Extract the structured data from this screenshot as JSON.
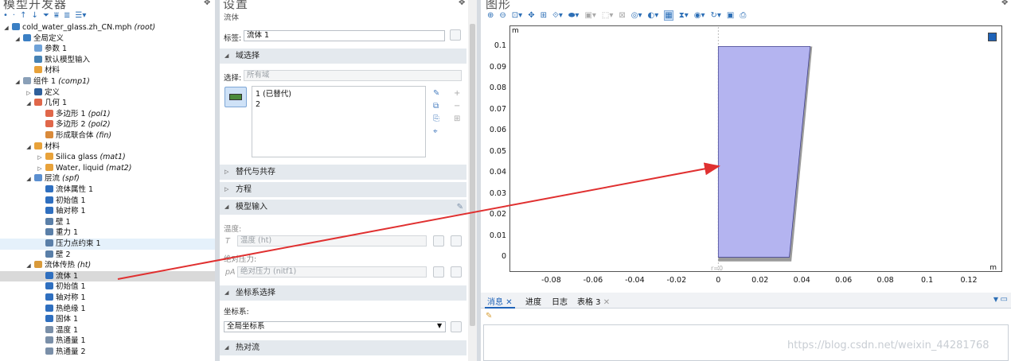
{
  "tree_panel": {
    "title": "模型开发器",
    "toolbar_icons": [
      "back-icon",
      "forward-icon",
      "up-icon",
      "down-icon",
      "filter-icon",
      "expand-all-icon",
      "collapse-all-icon",
      "view-menu-icon"
    ]
  },
  "tree": [
    {
      "indent": 0,
      "tw": "◢",
      "label": "cold_water_glass.zh_CN.mph",
      "tag": "(root)",
      "icon": "file-icon",
      "color": "#3b7fc4"
    },
    {
      "indent": 1,
      "tw": "◢",
      "label": "全局定义",
      "tag": "",
      "icon": "globe-icon",
      "color": "#3b7fc4"
    },
    {
      "indent": 2,
      "tw": "",
      "label": "参数 1",
      "tag": "",
      "icon": "parameters-icon",
      "color": "#6fa2d8"
    },
    {
      "indent": 2,
      "tw": "",
      "label": "默认模型输入",
      "tag": "",
      "icon": "model-inputs-icon",
      "color": "#4682b4"
    },
    {
      "indent": 2,
      "tw": "",
      "label": "材料",
      "tag": "",
      "icon": "materials-icon",
      "color": "#e8a23a"
    },
    {
      "indent": 1,
      "tw": "◢",
      "label": "组件 1",
      "tag": "(comp1)",
      "icon": "component-icon",
      "color": "#8aa0b8"
    },
    {
      "indent": 2,
      "tw": "▷",
      "label": "定义",
      "tag": "",
      "icon": "definitions-icon",
      "color": "#2f5f9a"
    },
    {
      "indent": 2,
      "tw": "◢",
      "label": "几何 1",
      "tag": "",
      "icon": "geometry-icon",
      "color": "#e0674a"
    },
    {
      "indent": 3,
      "tw": "",
      "label": "多边形 1",
      "tag": "(pol1)",
      "icon": "polygon-icon",
      "color": "#e0674a"
    },
    {
      "indent": 3,
      "tw": "",
      "label": "多边形 2",
      "tag": "(pol2)",
      "icon": "polygon-icon",
      "color": "#e0674a"
    },
    {
      "indent": 3,
      "tw": "",
      "label": "形成联合体",
      "tag": "(fin)",
      "icon": "form-union-icon",
      "color": "#d98a3a"
    },
    {
      "indent": 2,
      "tw": "◢",
      "label": "材料",
      "tag": "",
      "icon": "materials-icon",
      "color": "#e8a23a"
    },
    {
      "indent": 3,
      "tw": "▷",
      "label": "Silica glass",
      "tag": "(mat1)",
      "icon": "material-icon",
      "color": "#e8a23a"
    },
    {
      "indent": 3,
      "tw": "▷",
      "label": "Water, liquid",
      "tag": "(mat2)",
      "icon": "material-icon",
      "color": "#e8a23a"
    },
    {
      "indent": 2,
      "tw": "◢",
      "label": "层流",
      "tag": "(spf)",
      "icon": "laminar-flow-icon",
      "color": "#5b8fd0"
    },
    {
      "indent": 3,
      "tw": "",
      "label": "流体属性 1",
      "tag": "",
      "icon": "fluid-properties-icon",
      "color": "#2f6fbf"
    },
    {
      "indent": 3,
      "tw": "",
      "label": "初始值 1",
      "tag": "",
      "icon": "initial-values-icon",
      "color": "#2f6fbf"
    },
    {
      "indent": 3,
      "tw": "",
      "label": "轴对称 1",
      "tag": "",
      "icon": "axial-symmetry-icon",
      "color": "#2f6fbf"
    },
    {
      "indent": 3,
      "tw": "",
      "label": "壁 1",
      "tag": "",
      "icon": "wall-icon",
      "color": "#5a7fa8"
    },
    {
      "indent": 3,
      "tw": "",
      "label": "重力 1",
      "tag": "",
      "icon": "gravity-icon",
      "color": "#5a7fa8"
    },
    {
      "indent": 3,
      "tw": "",
      "label": "压力点约束 1",
      "tag": "",
      "icon": "pressure-point-icon",
      "color": "#5a7fa8",
      "hl": true
    },
    {
      "indent": 3,
      "tw": "",
      "label": "壁 2",
      "tag": "",
      "icon": "wall-icon",
      "color": "#5a7fa8"
    },
    {
      "indent": 2,
      "tw": "◢",
      "label": "流体传热",
      "tag": "(ht)",
      "icon": "heat-transfer-icon",
      "color": "#d99a3a"
    },
    {
      "indent": 3,
      "tw": "",
      "label": "流体 1",
      "tag": "",
      "icon": "fluid-icon",
      "color": "#2f6fbf",
      "sel": true
    },
    {
      "indent": 3,
      "tw": "",
      "label": "初始值 1",
      "tag": "",
      "icon": "initial-values-icon",
      "color": "#2f6fbf"
    },
    {
      "indent": 3,
      "tw": "",
      "label": "轴对称 1",
      "tag": "",
      "icon": "axial-symmetry-icon",
      "color": "#2f6fbf"
    },
    {
      "indent": 3,
      "tw": "",
      "label": "热绝缘 1",
      "tag": "",
      "icon": "thermal-insulation-icon",
      "color": "#2f6fbf"
    },
    {
      "indent": 3,
      "tw": "",
      "label": "固体 1",
      "tag": "",
      "icon": "solid-icon",
      "color": "#2f6fbf"
    },
    {
      "indent": 3,
      "tw": "",
      "label": "温度 1",
      "tag": "",
      "icon": "temperature-icon",
      "color": "#7a8fa8"
    },
    {
      "indent": 3,
      "tw": "",
      "label": "热通量 1",
      "tag": "",
      "icon": "heat-flux-icon",
      "color": "#7a8fa8"
    },
    {
      "indent": 3,
      "tw": "",
      "label": "热通量 2",
      "tag": "",
      "icon": "heat-flux-icon",
      "color": "#7a8fa8"
    }
  ],
  "settings": {
    "title": "设置",
    "subtitle": "流体",
    "label_caption": "标签:",
    "label_value": "流体 1",
    "sec_domain": "域选择",
    "selection_caption": "选择:",
    "selection_value": "所有域",
    "domain_item1": "1 (已替代)",
    "domain_item2": "2",
    "sec_override": "替代与共存",
    "sec_equation": "方程",
    "sec_model_input": "模型输入",
    "temp_caption": "温度:",
    "temp_symbol": "T",
    "temp_value": "温度 (ht)",
    "pressure_caption": "绝对压力:",
    "pressure_symbol": "pA",
    "pressure_value": "绝对压力 (nitf1)",
    "sec_coord": "坐标系选择",
    "coord_caption": "坐标系:",
    "coord_value": "全局坐标系",
    "sec_convection": "热对流"
  },
  "graphics": {
    "title": "图形",
    "unit_y": "m",
    "unit_x": "m",
    "r0_label": "r=0",
    "y_ticks": [
      "0.1",
      "0.09",
      "0.08",
      "0.07",
      "0.06",
      "0.05",
      "0.04",
      "0.03",
      "0.02",
      "0.01",
      "0"
    ],
    "x_ticks": [
      "-0.08",
      "-0.06",
      "-0.04",
      "-0.02",
      "0",
      "0.02",
      "0.04",
      "0.06",
      "0.08",
      "0.1",
      "0.12"
    ],
    "x_range": [
      -0.1,
      0.136
    ],
    "y_range": [
      -0.007,
      0.11
    ]
  },
  "messages": {
    "tabs": [
      "消息",
      "进度",
      "日志",
      "表格 3"
    ]
  },
  "watermark": "https://blog.csdn.net/weixin_44281768",
  "colors": {
    "domain_fill": "#b4b4f0",
    "arrow": "#e03030",
    "selection_bg": "#d9d9d9"
  }
}
